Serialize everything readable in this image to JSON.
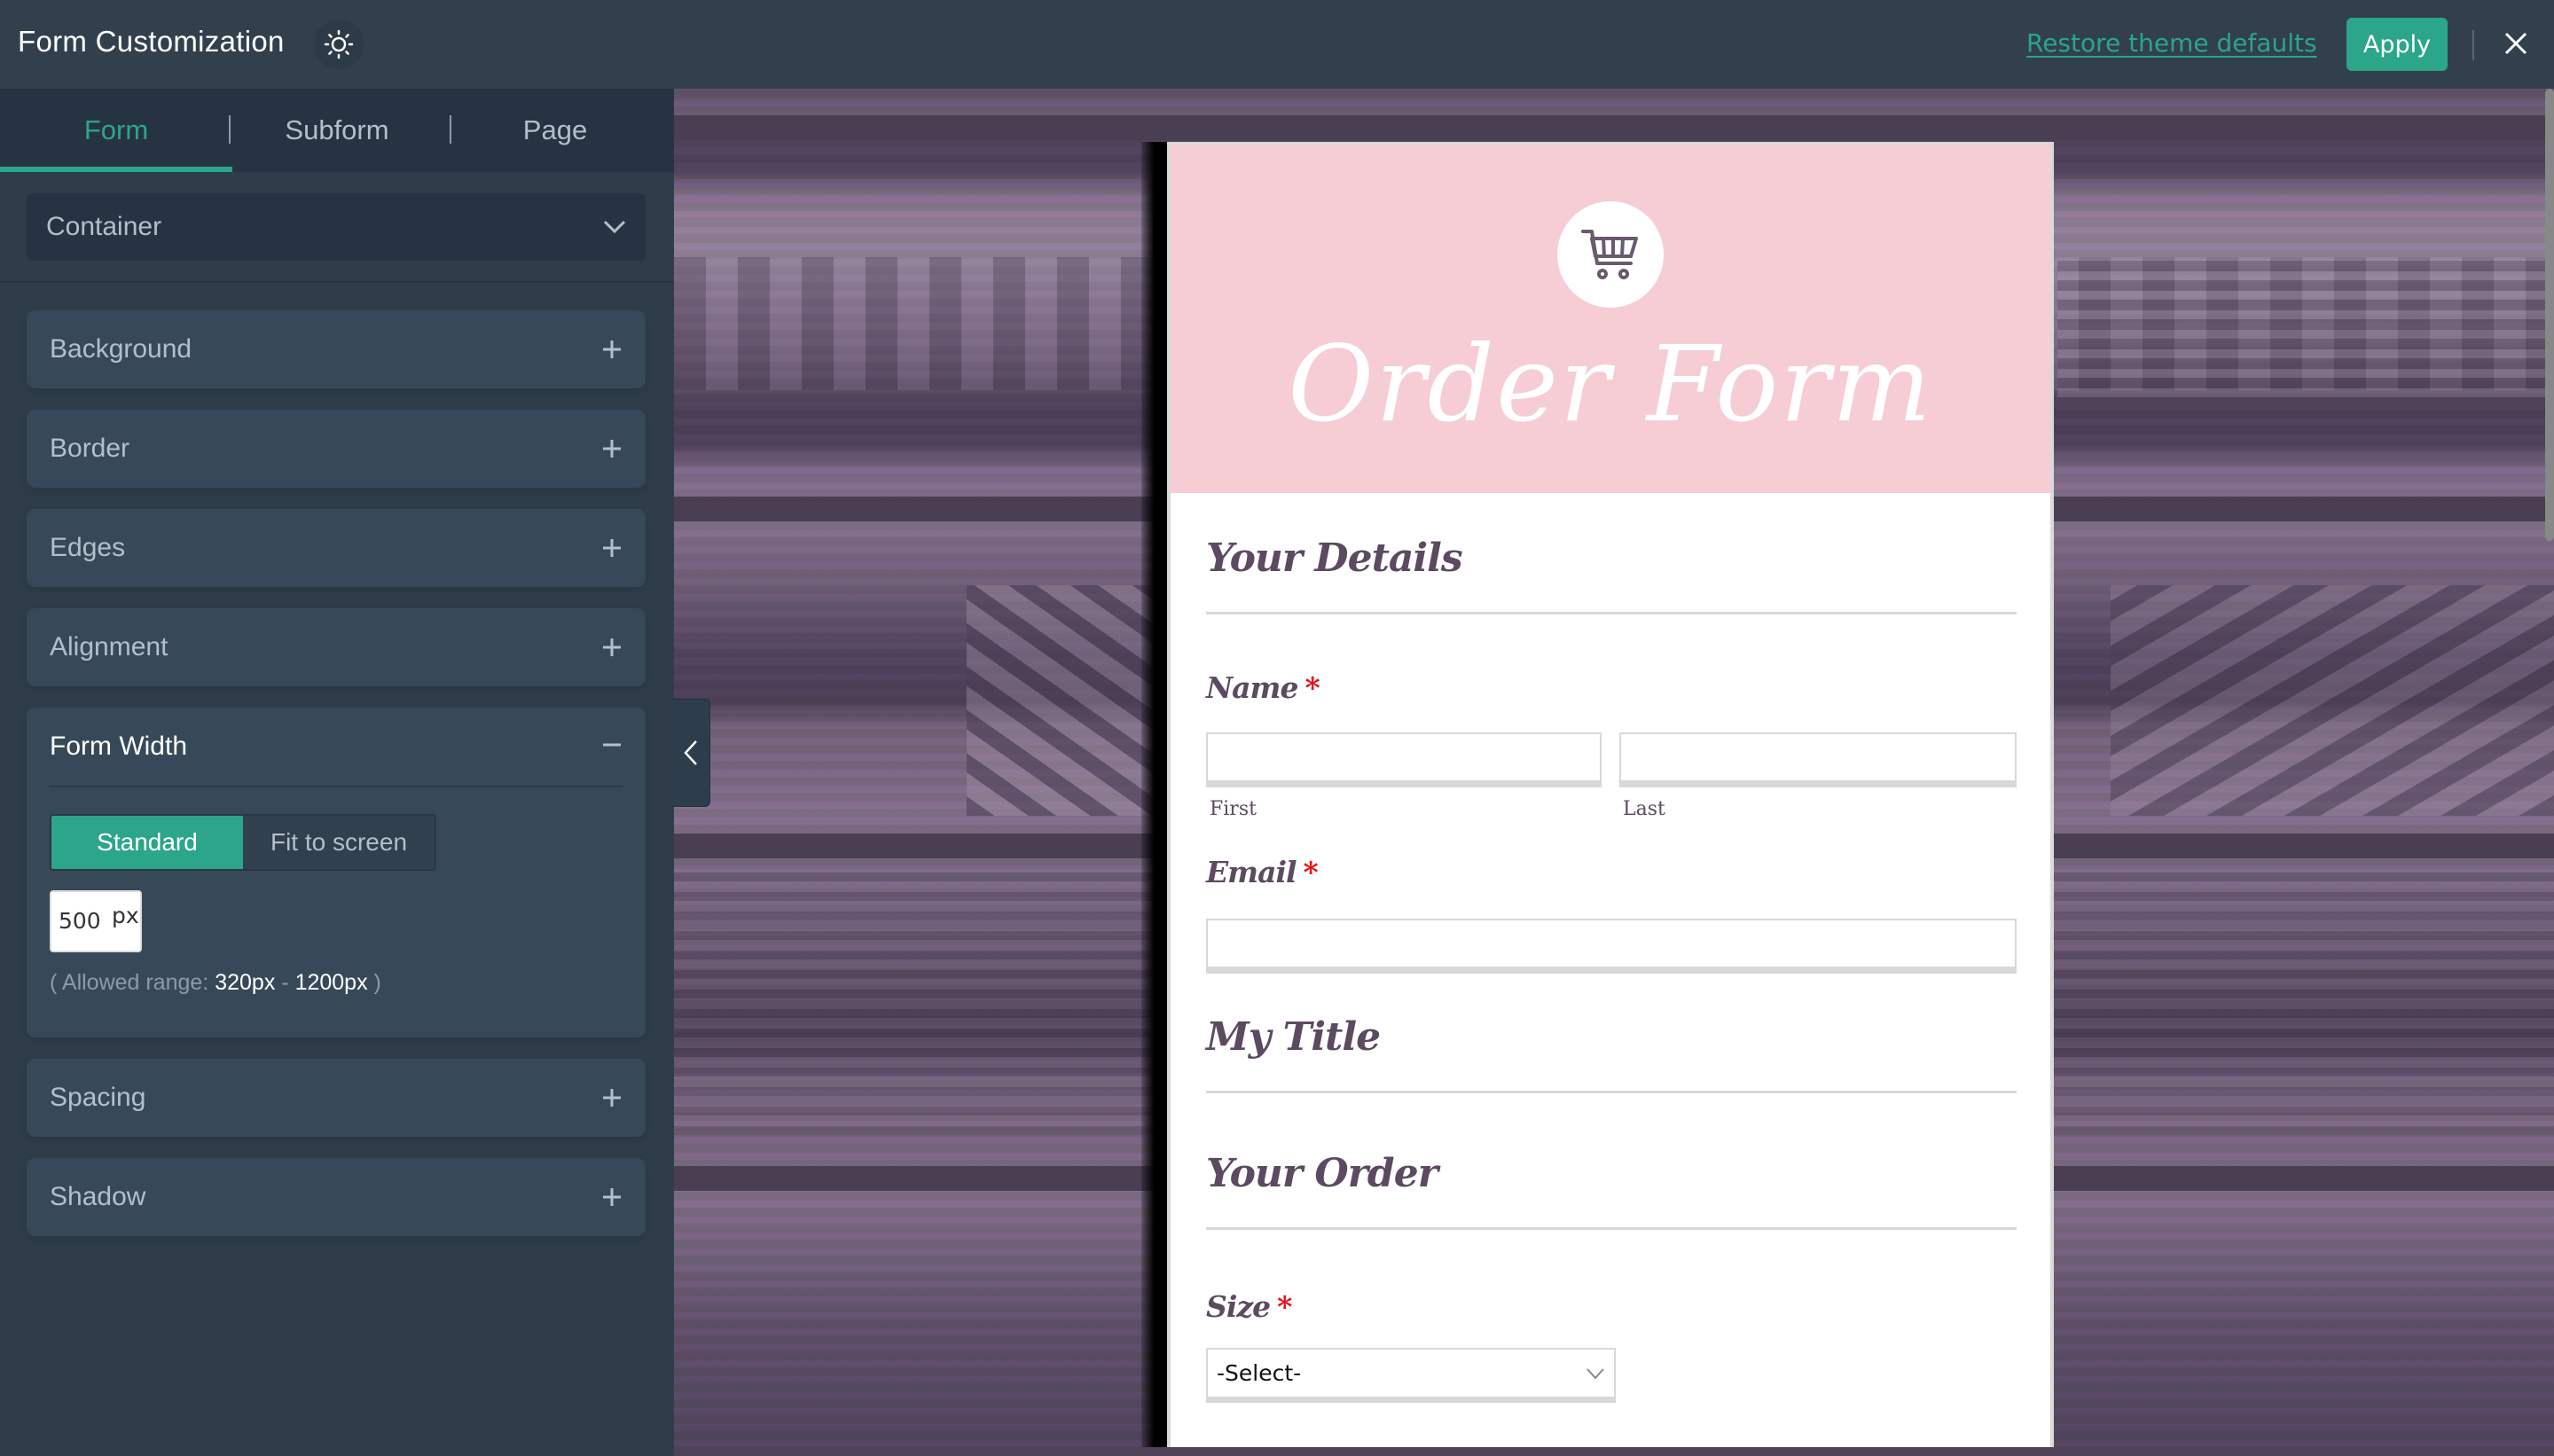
{
  "header": {
    "title": "Form Customization",
    "theme_toggle_icon": "sun-icon",
    "restore_label": "Restore theme defaults",
    "apply_label": "Apply",
    "close_icon": "close-icon"
  },
  "sidebar": {
    "tabs": [
      {
        "label": "Form",
        "active": true
      },
      {
        "label": "Subform",
        "active": false
      },
      {
        "label": "Page",
        "active": false
      }
    ],
    "section_select": {
      "value": "Container",
      "icon": "chevron-down-icon"
    },
    "panels": [
      {
        "label": "Background",
        "state": "collapsed",
        "icon": "plus-icon"
      },
      {
        "label": "Border",
        "state": "collapsed",
        "icon": "plus-icon"
      },
      {
        "label": "Edges",
        "state": "collapsed",
        "icon": "plus-icon"
      },
      {
        "label": "Alignment",
        "state": "collapsed",
        "icon": "plus-icon"
      },
      {
        "label": "Form Width",
        "state": "expanded",
        "icon": "minus-icon"
      },
      {
        "label": "Spacing",
        "state": "collapsed",
        "icon": "plus-icon"
      },
      {
        "label": "Shadow",
        "state": "collapsed",
        "icon": "plus-icon"
      }
    ],
    "form_width": {
      "modes": [
        {
          "label": "Standard",
          "active": true
        },
        {
          "label": "Fit to screen",
          "active": false
        }
      ],
      "value": "500",
      "unit": "px",
      "range_prefix": "( Allowed range: ",
      "range_min": "320px",
      "range_sep": " - ",
      "range_max": "1200px",
      "range_suffix": " )"
    },
    "collapse_icon": "chevron-left-icon"
  },
  "preview": {
    "logo_icon": "shopping-cart-icon",
    "form_title": "Order Form",
    "sections": {
      "your_details": "Your Details",
      "my_title": "My Title",
      "your_order": "Your Order"
    },
    "fields": {
      "name": {
        "label": "Name",
        "required_mark": "*",
        "first_sublabel": "First",
        "last_sublabel": "Last",
        "first_value": "",
        "last_value": ""
      },
      "email": {
        "label": "Email",
        "required_mark": "*",
        "value": ""
      },
      "size": {
        "label": "Size",
        "required_mark": "*",
        "selected": "-Select-"
      }
    }
  },
  "colors": {
    "accent": "#2ba68a",
    "header_bg": "#323f4d",
    "sidebar_bg": "#2f3d4b",
    "panel_bg": "#374958",
    "form_header_pink": "#f6ccd5",
    "form_text": "#5c4a60",
    "required": "#e4141b"
  }
}
